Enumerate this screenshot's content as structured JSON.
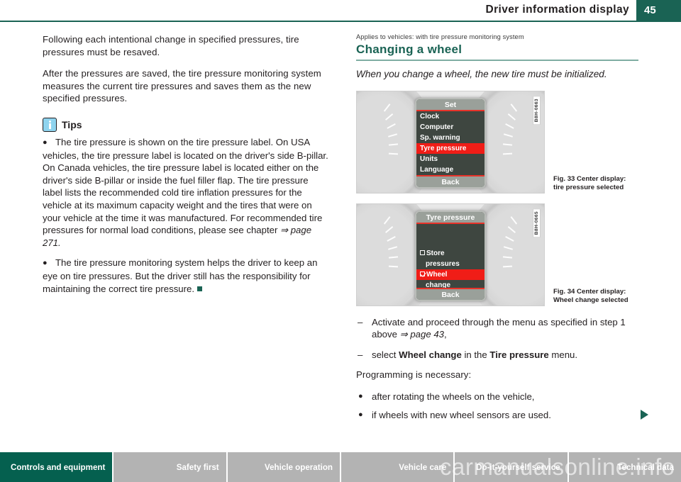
{
  "header": {
    "title": "Driver information display",
    "page_number": "45",
    "accent_color": "#1a6354"
  },
  "left_column": {
    "paragraphs": [
      "Following each intentional change in specified pressures, tire pressures must be resaved.",
      "After the pressures are saved, the tire pressure monitoring system measures the current tire pressures and saves them as the new specified pressures."
    ],
    "tips": {
      "label": "Tips",
      "icon": "info-icon",
      "icon_color": "#8fd4ef",
      "bullets": [
        {
          "text_before_ref": "The tire pressure is shown on the tire pressure label. On USA vehicles, the tire pressure label is located on the driver's side B-pillar. On Canada vehicles, the tire pressure label is located either on the driver's side B-pillar or inside the fuel filler flap. The tire pressure label lists the recommended cold tire inflation pressures for the vehicle at its maximum capacity weight and the tires that were on your vehicle at the time it was manufactured. For recommended tire pressures for normal load conditions, please see chapter ",
          "reference": "⇒ page 271.",
          "end_mark": false
        },
        {
          "text_before_ref": "The tire pressure monitoring system helps the driver to keep an eye on tire pressures. But the driver still has the responsibility for maintaining the correct tire pressure.",
          "reference": "",
          "end_mark": true
        }
      ]
    }
  },
  "right_column": {
    "applies_to": "Applies to vehicles: with tire pressure monitoring system",
    "section_heading": "Changing a wheel",
    "section_intro": "When you change a wheel, the new tire must be initialized.",
    "figures": [
      {
        "code": "B8H-0663",
        "caption_line1": "Fig. 33   Center display:",
        "caption_line2": "tire pressure selected",
        "display": {
          "title": "Set",
          "items": [
            {
              "label": "Clock",
              "selected": false,
              "checkbox": "none",
              "indent": false
            },
            {
              "label": "Computer",
              "selected": false,
              "checkbox": "none",
              "indent": false
            },
            {
              "label": "Sp. warning",
              "selected": false,
              "checkbox": "none",
              "indent": false
            },
            {
              "label": "Tyre pressure",
              "selected": true,
              "checkbox": "none",
              "indent": false
            },
            {
              "label": "Units",
              "selected": false,
              "checkbox": "none",
              "indent": false
            },
            {
              "label": "Language",
              "selected": false,
              "checkbox": "none",
              "indent": false
            }
          ],
          "back_label": "Back",
          "highlight_color": "#f01d17"
        }
      },
      {
        "code": "B8H-0665",
        "caption_line1": "Fig. 34   Center display:",
        "caption_line2": "Wheel change selected",
        "display": {
          "title": "Tyre pressure",
          "spacer": true,
          "items": [
            {
              "label": "Store",
              "selected": false,
              "checkbox": "unchecked",
              "indent": false
            },
            {
              "label": "pressures",
              "selected": false,
              "checkbox": "none",
              "indent": true
            },
            {
              "label": "Wheel",
              "selected": true,
              "checkbox": "checked",
              "indent": false
            },
            {
              "label": "change",
              "selected": false,
              "checkbox": "none",
              "indent": true
            }
          ],
          "back_label": "Back",
          "highlight_color": "#f01d17"
        }
      }
    ],
    "steps": [
      {
        "plain_1": "Activate and proceed through the menu as specified in step 1 above ",
        "ref": "⇒ page 43",
        "plain_2": ","
      },
      {
        "plain_1": "select ",
        "bold_1": "Wheel change",
        "plain_2": " in the ",
        "bold_2": "Tire pressure",
        "plain_3": " menu."
      }
    ],
    "programming_intro": "Programming is necessary:",
    "programming_bullets": [
      "after rotating the wheels on the vehicle,",
      "if wheels with new wheel sensors are used."
    ]
  },
  "footer": {
    "tabs": [
      {
        "label": "Controls and equipment",
        "active": true
      },
      {
        "label": "Safety first",
        "active": false
      },
      {
        "label": "Vehicle operation",
        "active": false
      },
      {
        "label": "Vehicle care",
        "active": false
      },
      {
        "label": "Do-it-yourself service",
        "active": false
      },
      {
        "label": "Technical data",
        "active": false
      }
    ],
    "watermark": "carmanualsonline.info"
  }
}
